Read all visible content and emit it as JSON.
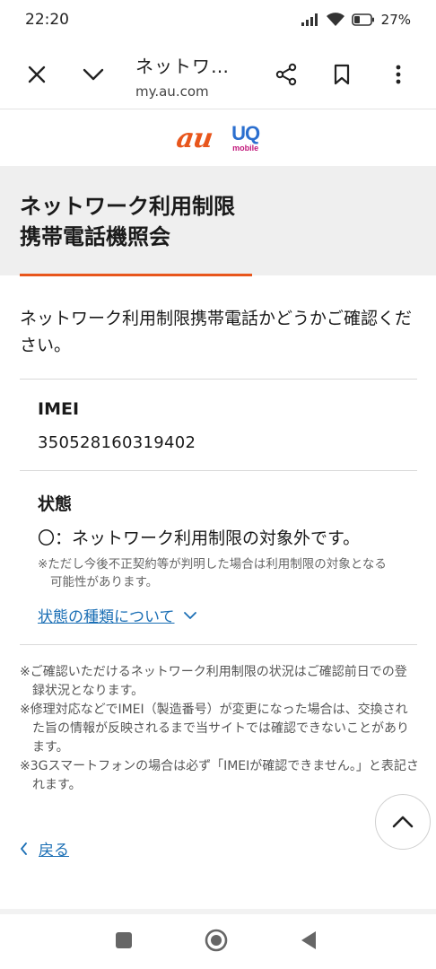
{
  "status_bar": {
    "time": "22:20",
    "battery_percent": "27%",
    "icons": [
      "signal-icon",
      "wifi-icon",
      "battery-icon"
    ]
  },
  "browser": {
    "tab_title": "ネットワ…",
    "url": "my.au.com",
    "icons": [
      "close-icon",
      "chevron-down-icon",
      "share-icon",
      "bookmark-icon",
      "more-vert-icon"
    ]
  },
  "logos": {
    "au": "au",
    "uq_main": "UQ",
    "uq_sub": "mobile"
  },
  "page": {
    "title": "ネットワーク利用制限\n携帯電話機照会",
    "intro": "ネットワーク利用制限携帯電話かどうかご確認ください。",
    "imei_label": "IMEI",
    "imei_value": "350528160319402",
    "status_label": "状態",
    "status_value": "〇：ネットワーク利用制限の対象外です。",
    "status_note": "※ただし今後不正契約等が判明した場合は利用制限の対象となる可能性があります。",
    "status_types_link": "状態の種類について",
    "notes": [
      "※ご確認いただけるネットワーク利用制限の状況はご確認前日での登録状況となります。",
      "※修理対応などでIMEI（製造番号）が変更になった場合は、交換された旨の情報が反映されるまで当サイトでは確認できないことがあります。",
      "※3Gスマートフォンの場合は必ず「IMEIが確認できません。」と表記されます。"
    ],
    "back_link": "戻る"
  },
  "colors": {
    "accent_orange": "#e8561c",
    "link_blue": "#1b6fb5",
    "uq_blue": "#2b6fcf",
    "uq_pink": "#c2187b"
  }
}
